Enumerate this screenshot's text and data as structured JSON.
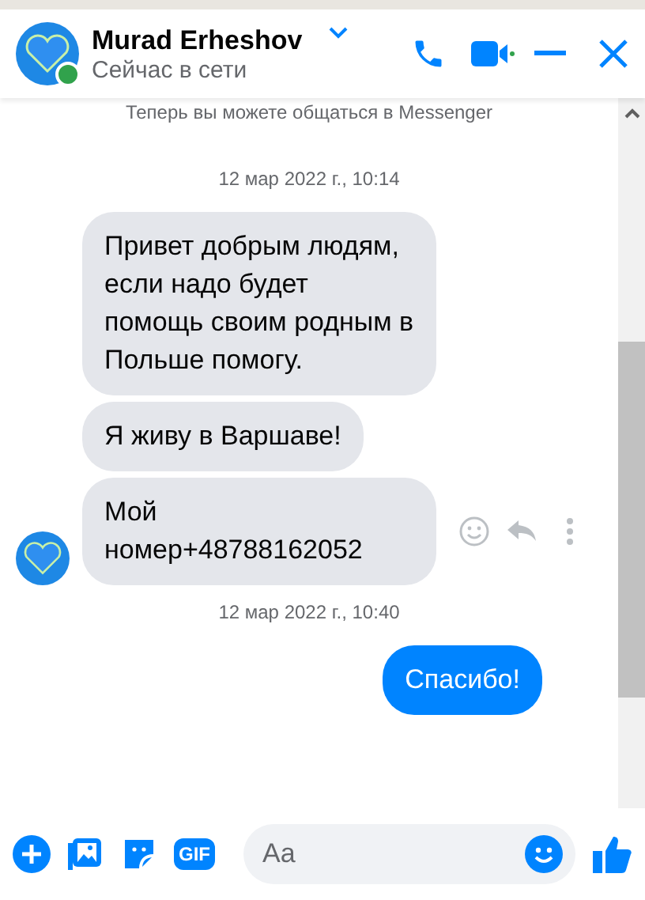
{
  "header": {
    "name": "Murad Erheshov",
    "status": "Сейчас в сети",
    "online": true
  },
  "intro": "Теперь вы можете общаться в Messenger",
  "groups": [
    {
      "timestamp": "12 мар 2022 г., 10:14",
      "messages": [
        {
          "kind": "incoming",
          "text": "Привет добрым людям, если надо будет помощь своим родным в Польше помогу."
        },
        {
          "kind": "incoming",
          "text": "Я живу в Варшаве!"
        },
        {
          "kind": "incoming",
          "text": "Мой номер+48788162052",
          "hovered": true
        }
      ]
    },
    {
      "timestamp": "12 мар 2022 г., 10:40",
      "messages": [
        {
          "kind": "outgoing",
          "text": "Спасибо!"
        }
      ]
    }
  ],
  "composer": {
    "gif_label": "GIF",
    "placeholder": "Aa"
  }
}
